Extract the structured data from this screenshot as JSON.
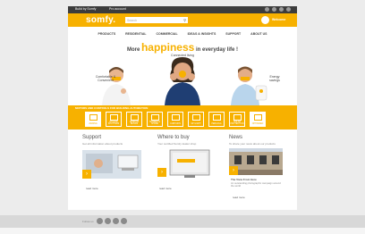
{
  "topbar": {
    "link1": "Build by Somfy",
    "link2": "Pro account"
  },
  "header": {
    "logo": "somfy.",
    "search_placeholder": "Search",
    "welcome": "Welcome"
  },
  "nav": [
    "PRODUCTS",
    "RESIDENTIAL",
    "COMMERCIAL",
    "IDEAS & INSIGHTS",
    "SUPPORT",
    "ABOUT US"
  ],
  "hero": {
    "prefix": "More",
    "highlight": "happiness",
    "suffix": "in everyday life !",
    "captions": [
      "Comfortable & Convenient",
      "Connected living",
      "Energy savings"
    ]
  },
  "band": {
    "label": "MOTORS AND CONTROLS FOR BUILDING AUTOMATION",
    "tiles": [
      "AWNING",
      "ROLLER SHUTTERS",
      "WINDOW BLINDS",
      "SCREEN & SHADE",
      "CURTAINS",
      "SKYLIGHT",
      "PERGOLA",
      "SOLAR PROTECTION",
      "OPTIMIZED"
    ]
  },
  "columns": [
    {
      "title": "Support",
      "sub": "Get all information about products",
      "more": "read more"
    },
    {
      "title": "Where to buy",
      "sub": "Your certified Somfy dealer shop",
      "more": "read more"
    },
    {
      "title": "News",
      "sub": "To share your news about our products",
      "more": "read more",
      "headline": "The View From Here",
      "teaser": "An outstanding photographic campaign around the world"
    }
  ],
  "footer": {
    "label": "Follow us"
  },
  "colors": {
    "brand": "#f7b100",
    "dark": "#3c3c3c"
  }
}
